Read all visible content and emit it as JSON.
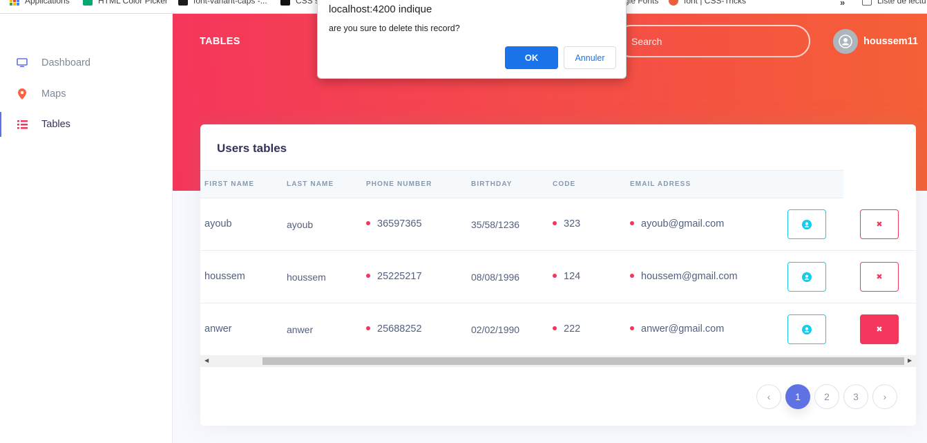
{
  "bookmarks": {
    "items": [
      {
        "label": "Applications",
        "icon": "apps-grid-icon"
      },
      {
        "label": "HTML Color Picker",
        "icon": "w3-icon"
      },
      {
        "label": "font-variant-caps -...",
        "icon": "mdn-icon"
      },
      {
        "label": "CSS s",
        "icon": "bookmark-icon"
      },
      {
        "label": "gle Fonts",
        "icon": "google-fonts-icon"
      },
      {
        "label": "font | CSS-Tricks",
        "icon": "css-tricks-icon"
      }
    ],
    "more": "»",
    "reading_list": "Liste de lectu"
  },
  "sidebar": {
    "items": [
      {
        "label": "Dashboard",
        "icon": "monitor-icon",
        "color": "#5e72e4"
      },
      {
        "label": "Maps",
        "icon": "pin-icon",
        "color": "#fb6340"
      },
      {
        "label": "Tables",
        "icon": "list-icon",
        "color": "#f5365c"
      }
    ],
    "active": "Tables"
  },
  "header": {
    "brand": "TABLES",
    "search_placeholder": "Search",
    "username": "houssem11"
  },
  "card": {
    "title": "Users tables",
    "columns": [
      "FIRST NAME",
      "LAST NAME",
      "PHONE NUMBER",
      "BIRTHDAY",
      "CODE",
      "EMAIL ADRESS"
    ],
    "rows": [
      {
        "first": "ayoub",
        "last": "ayoub",
        "phone": "36597365",
        "birthday": "35/58/1236",
        "code": "323",
        "email": "ayoub@gmail.com"
      },
      {
        "first": "houssem",
        "last": "houssem",
        "phone": "25225217",
        "birthday": "08/08/1996",
        "code": "124",
        "email": "houssem@gmail.com"
      },
      {
        "first": "anwer",
        "last": "anwer",
        "phone": "25688252",
        "birthday": "02/02/1990",
        "code": "222",
        "email": "anwer@gmail.com"
      }
    ],
    "delete_glyph": "✖"
  },
  "pagination": {
    "prev": "‹",
    "pages": [
      "1",
      "2",
      "3"
    ],
    "active": "1",
    "next": "›"
  },
  "dialog": {
    "title": "localhost:4200 indique",
    "message": "are you sure to delete this record?",
    "ok": "OK",
    "cancel": "Annuler"
  },
  "colors": {
    "gradient_start": "#f5365c",
    "gradient_end": "#f56036",
    "primary": "#5e72e4",
    "info": "#11cdef",
    "danger": "#f5365c"
  }
}
